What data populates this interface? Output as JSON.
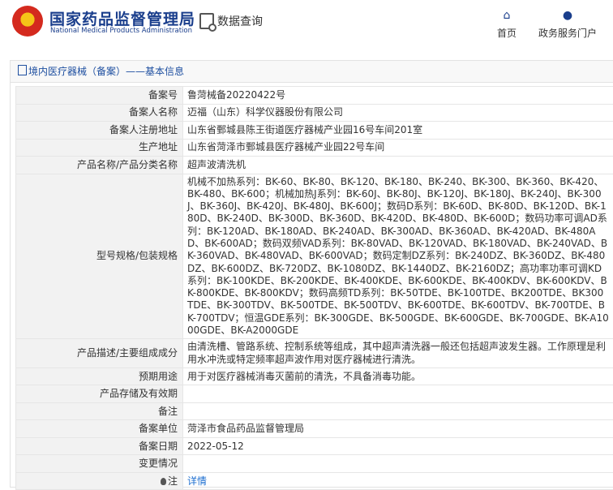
{
  "header": {
    "title_cn": "国家药品监督管理局",
    "title_en": "National Medical Products Administration",
    "search_tab": "数据查询",
    "nav": [
      {
        "label": "首页",
        "icon": "home-icon"
      },
      {
        "label": "政务服务门户",
        "icon": "user-icon"
      }
    ]
  },
  "panel": {
    "title": "境内医疗器械（备案）——基本信息",
    "rows": [
      {
        "key": "备案号",
        "value": "鲁菏械备20220422号"
      },
      {
        "key": "备案人名称",
        "value": "迈福（山东）科学仪器股份有限公司"
      },
      {
        "key": "备案人注册地址",
        "value": "山东省鄄城县陈王街道医疗器械产业园16号车间201室"
      },
      {
        "key": "生产地址",
        "value": "山东省菏泽市鄄城县医疗器械产业园22号车间"
      },
      {
        "key": "产品名称/产品分类名称",
        "value": "超声波清洗机"
      },
      {
        "key": "型号规格/包装规格",
        "value": "机械不加热系列：BK-60、BK-80、BK-120、BK-180、BK-240、BK-300、BK-360、BK-420、BK-480、BK-600；机械加热J系列：BK-60J、BK-80J、BK-120J、BK-180J、BK-240J、BK-300J、BK-360J、BK-420J、BK-480J、BK-600J；数码D系列：BK-60D、BK-80D、BK-120D、BK-180D、BK-240D、BK-300D、BK-360D、BK-420D、BK-480D、BK-600D；数码功率可调AD系列：BK-120AD、BK-180AD、BK-240AD、BK-300AD、BK-360AD、BK-420AD、BK-480AD、BK-600AD；数码双频VAD系列：BK-80VAD、BK-120VAD、BK-180VAD、BK-240VAD、BK-360VAD、BK-480VAD、BK-600VAD；数码定制DZ系列：BK-240DZ、BK-360DZ、BK-480DZ、BK-600DZ、BK-720DZ、BK-1080DZ、BK-1440DZ、BK-2160DZ；高功率功率可调KD系列：BK-100KDE、BK-200KDE、BK-400KDE、BK-600KDE、BK-400KDV、BK-600KDV、BK-800KDE、BK-800KDV；数码高频TD系列：BK-50TDE、BK-100TDE、BK200TDE、BK300TDE、BK-300TDV、BK-500TDE、BK-500TDV、BK-600TDE、BK-600TDV、BK-700TDE、BK-700TDV；恒温GDE系列：BK-300GDE、BK-500GDE、BK-600GDE、BK-700GDE、BK-A1000GDE、BK-A2000GDE"
      },
      {
        "key": "产品描述/主要组成成分",
        "value": "由清洗槽、管路系统、控制系统等组成，其中超声清洗器一般还包括超声波发生器。工作原理是利用水冲洗或特定频率超声波作用对医疗器械进行清洗。"
      },
      {
        "key": "预期用途",
        "value": "用于对医疗器械消毒灭菌前的清洗，不具备消毒功能。"
      },
      {
        "key": "产品存储及有效期",
        "value": ""
      },
      {
        "key": "备注",
        "value": ""
      },
      {
        "key": "备案单位",
        "value": "菏泽市食品药品监督管理局"
      },
      {
        "key": "备案日期",
        "value": "2022-05-12"
      },
      {
        "key": "变更情况",
        "value": ""
      },
      {
        "key": "注",
        "value": "详情"
      }
    ]
  },
  "colors": {
    "brand": "#1a3e8c",
    "link": "#1e6fd0",
    "key_bg": "#f2f2f2"
  }
}
